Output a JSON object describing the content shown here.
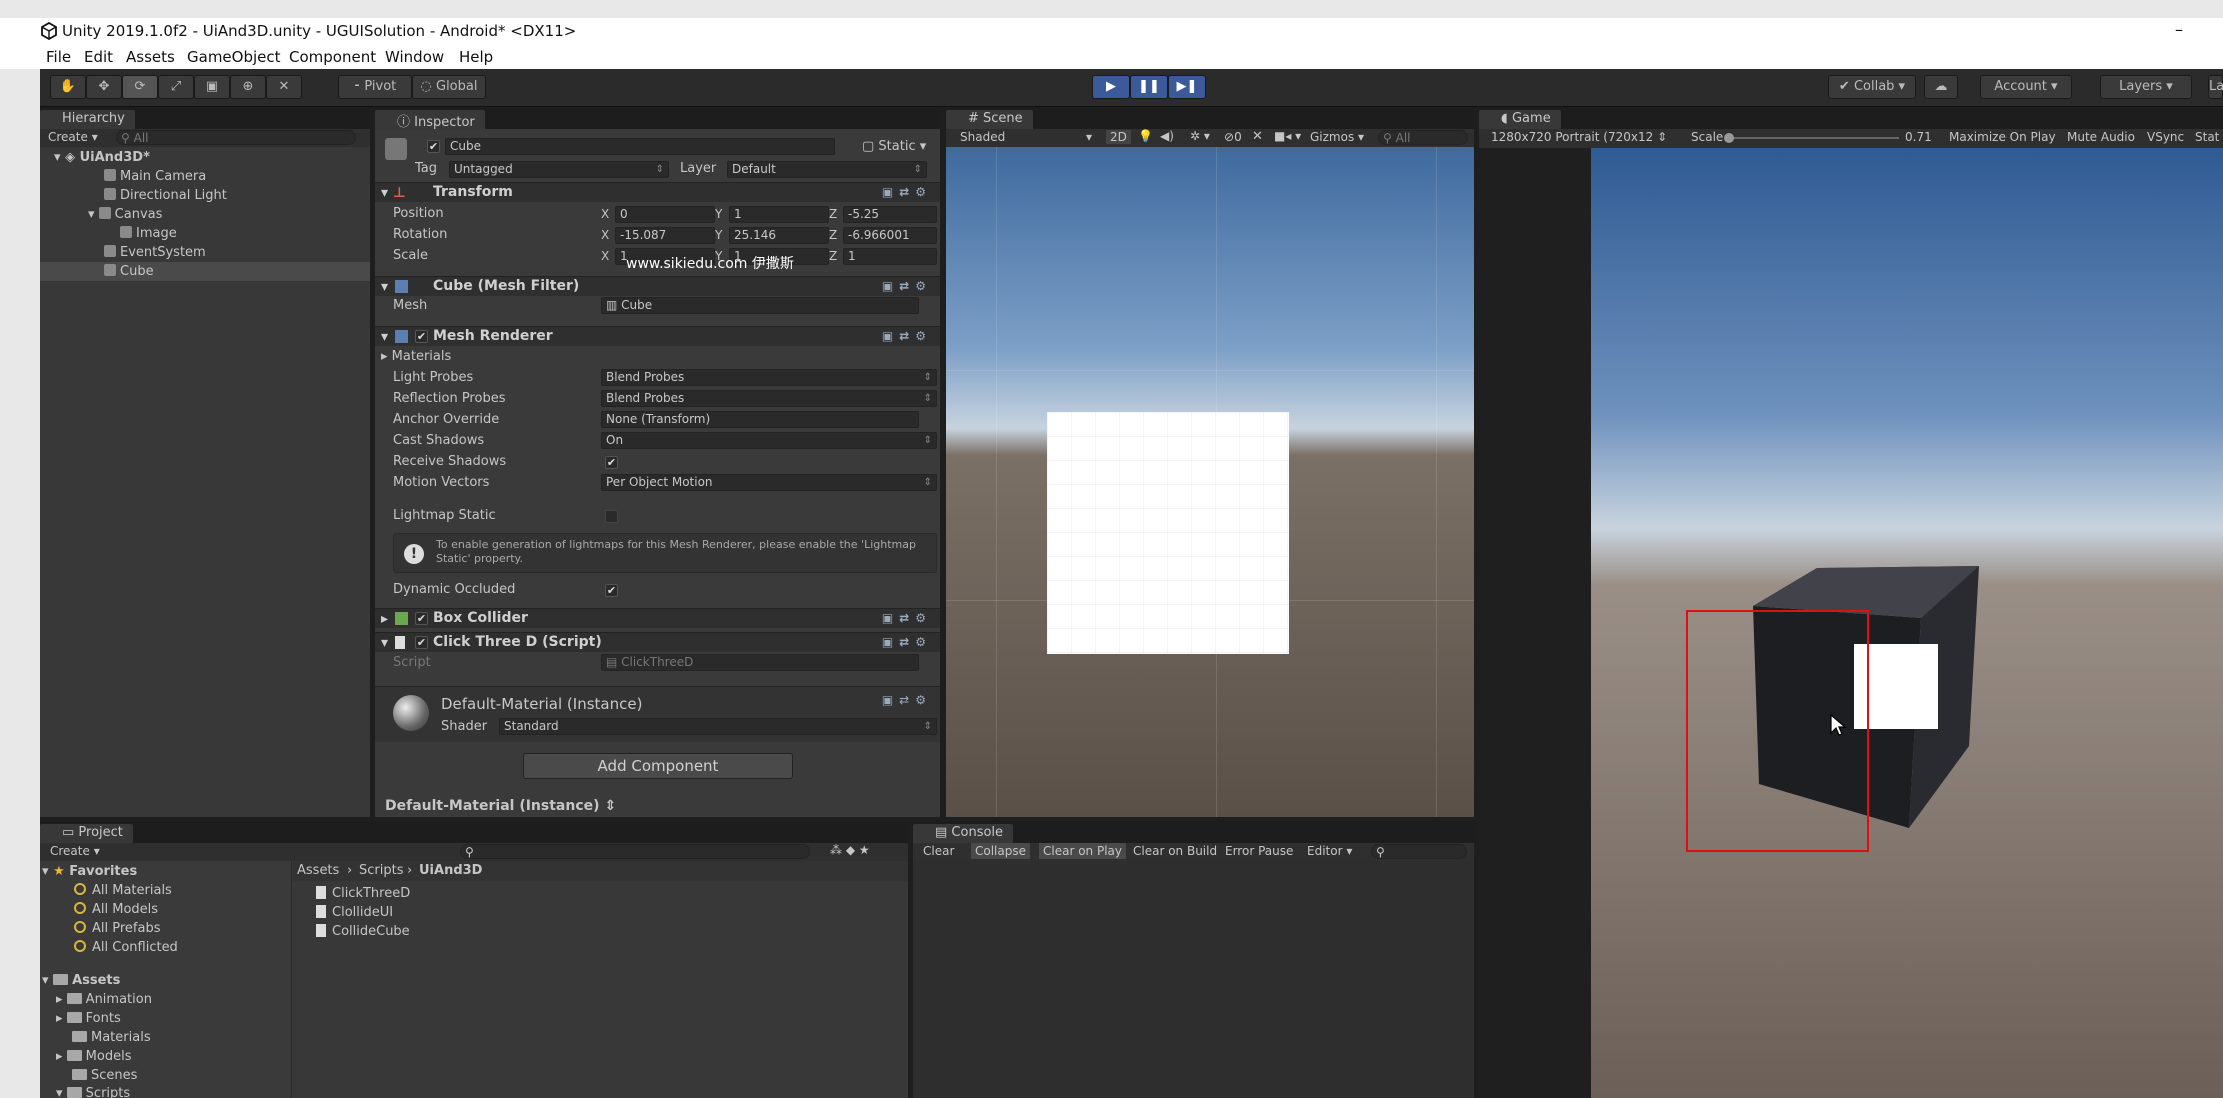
{
  "window": {
    "title": "Unity 2019.1.0f2 - UiAnd3D.unity - UGUISolution - Android* <DX11>",
    "minimize": "–"
  },
  "menu": [
    "File",
    "Edit",
    "Assets",
    "GameObject",
    "Component",
    "Window",
    "Help"
  ],
  "toolbar": {
    "pivot": "Pivot",
    "global": "Global",
    "collab": "Collab",
    "account": "Account",
    "layers": "Layers",
    "layout": "La"
  },
  "hierarchy": {
    "tab": "Hierarchy",
    "create": "Create",
    "search_placeholder": "All",
    "scene": "UiAnd3D*",
    "items": [
      "Main Camera",
      "Directional Light",
      "Canvas",
      "Image",
      "EventSystem",
      "Cube"
    ]
  },
  "inspector": {
    "tab": "Inspector",
    "object_name": "Cube",
    "static_label": "Static",
    "tag_label": "Tag",
    "tag_value": "Untagged",
    "layer_label": "Layer",
    "layer_value": "Default",
    "transform": {
      "title": "Transform",
      "position_label": "Position",
      "rotation_label": "Rotation",
      "scale_label": "Scale",
      "position": {
        "x": "0",
        "y": "1",
        "z": "-5.25"
      },
      "rotation": {
        "x": "-15.087",
        "y": "25.146",
        "z": "-6.966001"
      },
      "scale": {
        "x": "1",
        "y": "1",
        "z": "1"
      },
      "axis_x": "X",
      "axis_y": "Y",
      "axis_z": "Z"
    },
    "watermark": "www.sikiedu.com 伊撒斯",
    "mesh_filter": {
      "title": "Cube (Mesh Filter)",
      "mesh_label": "Mesh",
      "mesh_value": "Cube"
    },
    "mesh_renderer": {
      "title": "Mesh Renderer",
      "materials": "Materials",
      "light_probes_label": "Light Probes",
      "light_probes_value": "Blend Probes",
      "reflection_probes_label": "Reflection Probes",
      "reflection_probes_value": "Blend Probes",
      "anchor_label": "Anchor Override",
      "anchor_value": "None (Transform)",
      "cast_label": "Cast Shadows",
      "cast_value": "On",
      "receive_label": "Receive Shadows",
      "motion_label": "Motion Vectors",
      "motion_value": "Per Object Motion",
      "lightmap_label": "Lightmap Static",
      "info": "To enable generation of lightmaps for this Mesh Renderer, please enable the 'Lightmap Static' property.",
      "dynamic_label": "Dynamic Occluded"
    },
    "box_collider": "Box Collider",
    "script_comp": {
      "title": "Click Three D (Script)",
      "script_label": "Script",
      "script_value": "ClickThreeD"
    },
    "material": {
      "name": "Default-Material (Instance)",
      "shader_label": "Shader",
      "shader_value": "Standard"
    },
    "add_component": "Add Component",
    "footer": "Default-Material (Instance)"
  },
  "scene": {
    "tab": "Scene",
    "shaded": "Shaded",
    "mode_2d": "2D",
    "gizmos": "Gizmos",
    "search": "All",
    "hidden_count": "0"
  },
  "game": {
    "tab": "Game",
    "resolution": "1280x720 Portrait (720x12",
    "scale_label": "Scale",
    "scale_value": "0.71",
    "maximize": "Maximize On Play",
    "mute": "Mute Audio",
    "vsync": "VSync",
    "stats": "Stat"
  },
  "project": {
    "tab": "Project",
    "create": "Create",
    "favorites": "Favorites",
    "fav_items": [
      "All Materials",
      "All Models",
      "All Prefabs",
      "All Conflicted"
    ],
    "assets": "Assets",
    "asset_folders": [
      "Animation",
      "Fonts",
      "Materials",
      "Models",
      "Scenes",
      "Scripts"
    ],
    "breadcrumb": [
      "Assets",
      "Scripts",
      "UiAnd3D"
    ],
    "files": [
      "ClickThreeD",
      "ClollideUI",
      "CollideCube"
    ]
  },
  "console": {
    "tab": "Console",
    "buttons": [
      "Clear",
      "Collapse",
      "Clear on Play",
      "Clear on Build",
      "Error Pause",
      "Editor"
    ]
  },
  "colors": {
    "highlight_box": "#e01010",
    "play_blue": "#3c5a99"
  }
}
